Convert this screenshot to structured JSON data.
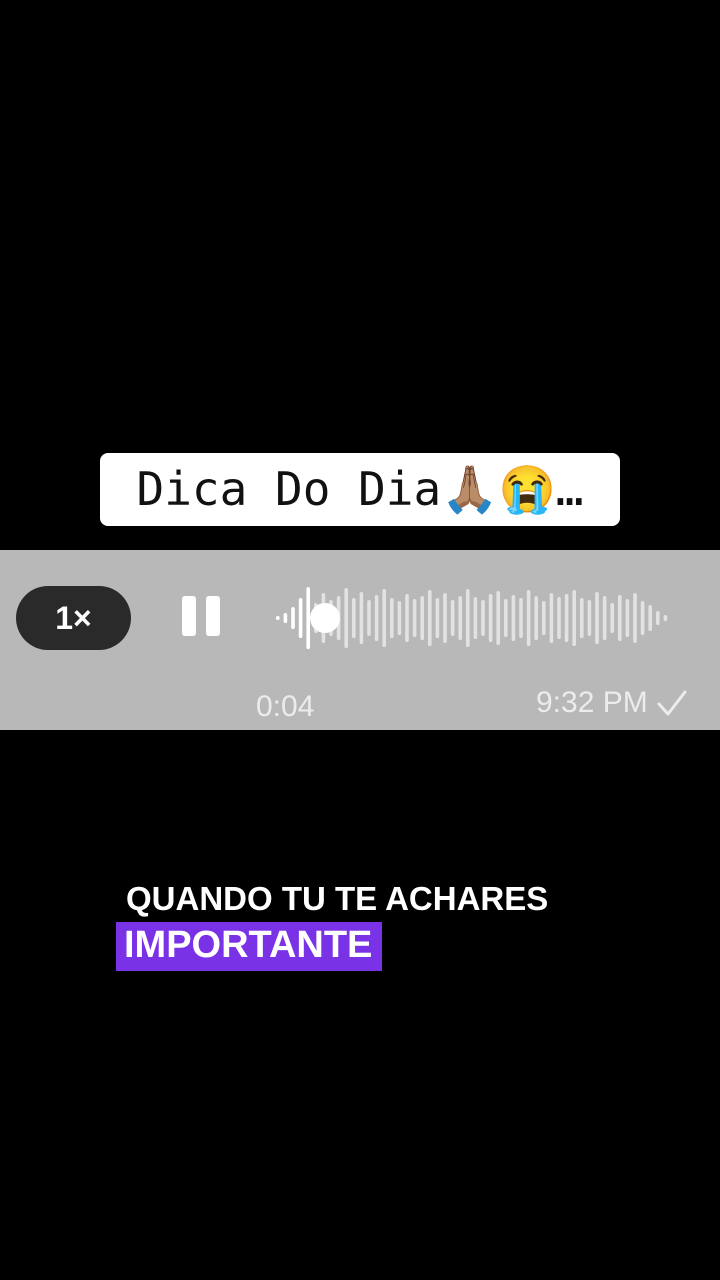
{
  "title": {
    "text": "Dica Do Dia🙏🏽😭…"
  },
  "audio_player": {
    "speed_label": "1×",
    "elapsed_time": "0:04",
    "timestamp": "9:32 PM",
    "progress_fraction": 0.1,
    "icons": {
      "pause": "pause-icon",
      "read_receipt": "check-icon"
    },
    "colors": {
      "bar_background": "#b8b8b8",
      "pill_background": "#2a2a2a",
      "text": "#ececec"
    }
  },
  "caption": {
    "line1": "QUANDO TU TE ACHARES",
    "line2": "IMPORTANTE",
    "highlight_color": "#7a32e6"
  }
}
